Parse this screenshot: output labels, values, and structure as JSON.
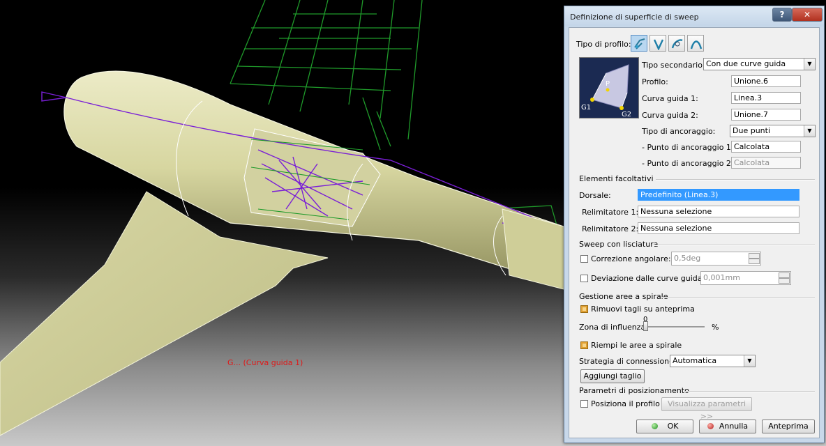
{
  "viewport": {
    "annotation": "G... (Curva guida 1)"
  },
  "dialog": {
    "title": "Definizione di superficie di sweep",
    "help_label": "?",
    "close_label": "✕",
    "profile_type_label": "Tipo di profilo:",
    "profile_type_icons": [
      "explicit-profile-icon",
      "linear-profile-icon",
      "circle-profile-icon",
      "conic-profile-icon"
    ],
    "subtype_label": "Tipo secondario:",
    "subtype_value": "Con due curve guida",
    "preview_labels": {
      "g1": "G1",
      "p": "P",
      "g2": "G2"
    },
    "profilo_label": "Profilo:",
    "profilo_value": "Unione.6",
    "guida1_label": "Curva guida 1:",
    "guida1_value": "Linea.3",
    "guida2_label": "Curva guida 2:",
    "guida2_value": "Unione.7",
    "ancoraggio_label": "Tipo di ancoraggio:",
    "ancoraggio_value": "Due punti",
    "punto1_label": "- Punto di ancoraggio 1:",
    "punto1_value": "Calcolata",
    "punto2_label": "- Punto di ancoraggio 2:",
    "punto2_value": "Calcolata",
    "optional_section": "Elementi facoltativi",
    "dorsale_label": "Dorsale:",
    "dorsale_value": "Predefinito (Linea.3)",
    "relim1_label": "Relimitatore 1:",
    "relim1_value": "Nessuna selezione",
    "relim2_label": "Relimitatore 2:",
    "relim2_value": "Nessuna selezione",
    "smoothing_section": "Sweep con lisciatura",
    "angular_label": "Correzione angolare:",
    "angular_value": "0,5deg",
    "deviation_label": "Deviazione dalle curve guida:",
    "deviation_value": "0,001mm",
    "twist_section": "Gestione aree a spirale",
    "remove_cuts_label": "Rimuovi tagli su anteprima",
    "influence_label": "Zona di influenza",
    "influence_value": "0",
    "influence_unit": "%",
    "fill_twist_label": "Riempi le aree a spirale",
    "connection_label": "Strategia di connessione:",
    "connection_value": "Automatica",
    "add_cut_label": "Aggiungi taglio",
    "positioning_section": "Parametri di posizionamento",
    "position_profile_label": "Posiziona il profilo",
    "show_params_label": "Visualizza parametri >>",
    "ok_label": "OK",
    "cancel_label": "Annulla",
    "preview_label": "Anteprima"
  },
  "colors": {
    "surface": "#d9d9a8",
    "wire_green": "#1f9a2a",
    "wire_purple": "#7a1fd6",
    "selection": "#3399ff",
    "checked": "#e0a033"
  }
}
